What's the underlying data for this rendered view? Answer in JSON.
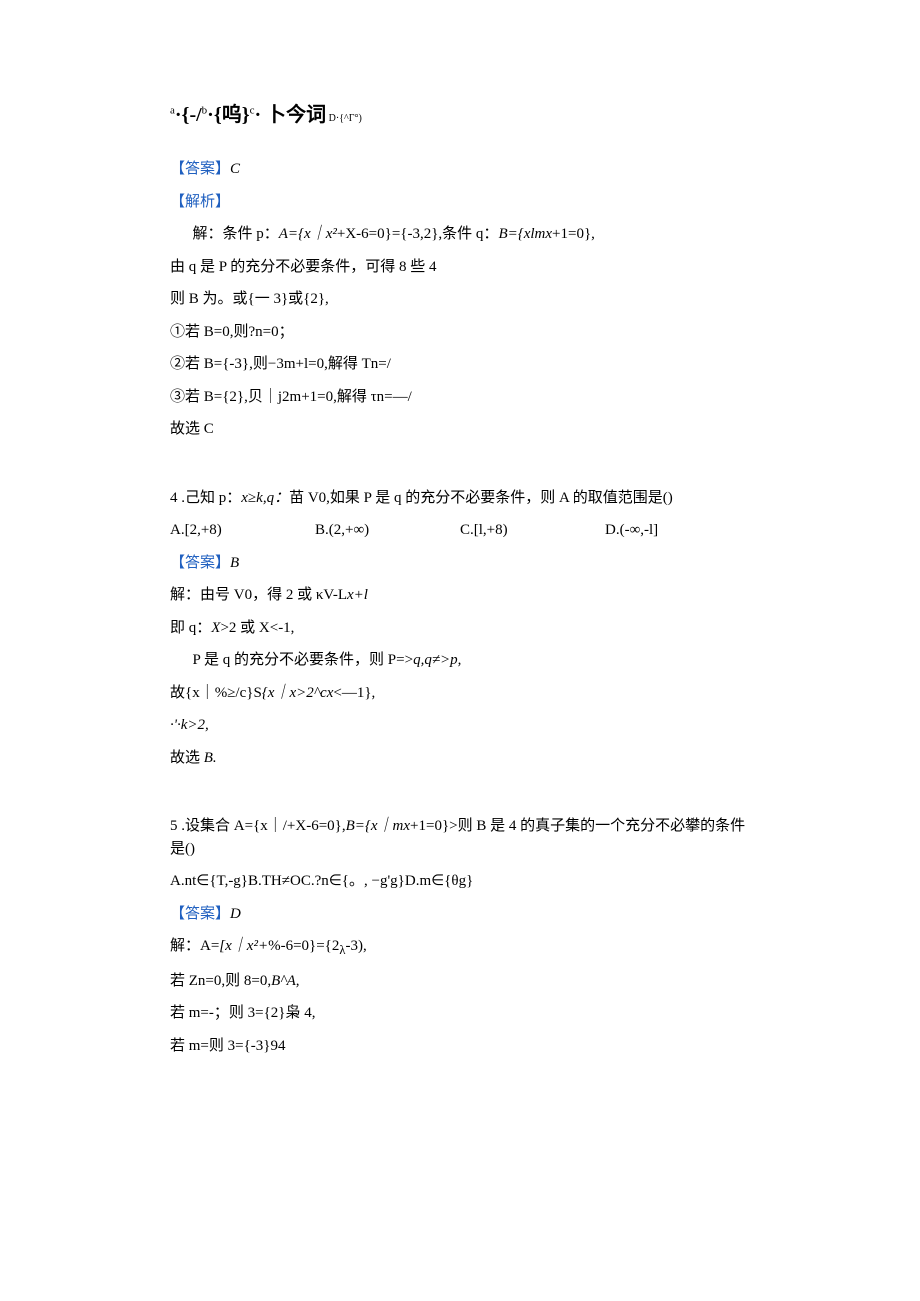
{
  "q3_options": {
    "a_sup": "a",
    "a_text": "·{-/",
    "b_sup": "b",
    "b_text": "·{呜}",
    "c_sup": "c",
    "c_text": "· 卜今词",
    "d_small": " D·{^Γ°)"
  },
  "q3": {
    "answer_label": "【答案】",
    "answer_value": "C",
    "explain_label": "【解析】",
    "l1": "解：条件 p：",
    "l1_i": "A={x｜x²",
    "l1b": "+X-6=0}={-3,2},条件 q：",
    "l1c": "B={xlmx",
    "l1d": "+1=0},",
    "l2": "由 q 是 P 的充分不必要条件，可得 8 些 4",
    "l3": "则 B 为。或{一 3}或{2},",
    "l4": "①若 B=0,则?n=0；",
    "l5": "②若 B={-3},则−3m+l=0,解得 Tn=/",
    "l6": "③若 B={2},贝｜j2m+1=0,解得 τn=—/",
    "l7": "故选 C"
  },
  "q4": {
    "stem_a": "4 .己知 p：",
    "stem_i": "x≥k,q：",
    "stem_b": "苗 V0,如果 P 是 q 的充分不必要条件，则 A 的取值范围是()",
    "optA": "A.[2,+8)",
    "optB": "B.(2,+∞)",
    "optC": "C.[l,+8)",
    "optD": "D.(-∞,-l]",
    "answer_label": "【答案】",
    "answer_value": "B",
    "l1": "解：由号 V0，得 2 或 κV-L",
    "l1_i": "x+l",
    "l2a": "即 q：",
    "l2_i": "X",
    "l2b": ">2 或 X<-1,",
    "l3a": "P 是 q 的充分不必要条件，则 P=>",
    "l3_i": "q,q≠>p,",
    "l4a": "故{x｜%≥/c}S",
    "l4_i": "{x｜x>2^cx",
    "l4b": "<—1},",
    "l5_i": "·'·k>2,",
    "l6a": "故选 ",
    "l6_i": "B."
  },
  "q5": {
    "stem_a": "5 .设集合 A={x｜/+X-6=0},",
    "stem_i": "B={x｜mx",
    "stem_b": "+1=0}>则 B 是 4 的真子集的一个充分不必攀的条件是()",
    "opts": "A.nt∈{T,-g}B.TH≠OC.?n∈{。, −g'g}D.m∈{θg}",
    "answer_label": "【答案】",
    "answer_value": "D",
    "l1a": "解：A=",
    "l1_i": "[x｜x²+",
    "l1b": "%-6=0}={2",
    "l1sub": "λ",
    "l1c": "-3),",
    "l2a": "若 Zn=0,则 8=0,",
    "l2_i": "B^A,",
    "l3": "若 m=-；则 3={2}枭 4,",
    "l4": "若 m=则 3={-3}94"
  }
}
